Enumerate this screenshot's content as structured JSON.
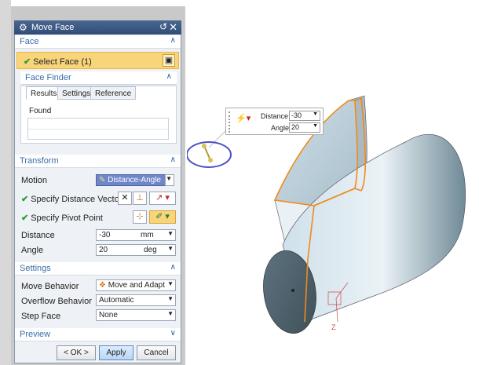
{
  "dialog": {
    "title": "Move Face",
    "reset_icon": "↺",
    "close_icon": "✕",
    "face_section": "Face",
    "select_face": "Select Face (1)",
    "face_finder": "Face Finder",
    "tabs": [
      "Results",
      "Settings",
      "Reference"
    ],
    "found_label": "Found",
    "transform_section": "Transform",
    "motion_label": "Motion",
    "motion_value": "Distance-Angle",
    "distance_vector_label": "Specify Distance Vector",
    "pivot_point_label": "Specify Pivot Point",
    "distance_label": "Distance",
    "distance_value": "-30",
    "distance_unit": "mm",
    "angle_label": "Angle",
    "angle_value": "20",
    "angle_unit": "deg",
    "settings_section": "Settings",
    "move_behavior_label": "Move Behavior",
    "move_behavior_value": "Move and Adapt",
    "overflow_label": "Overflow Behavior",
    "overflow_value": "Automatic",
    "step_face_label": "Step Face",
    "step_face_value": "None",
    "preview_section": "Preview",
    "ok_label": "< OK >",
    "apply_label": "Apply",
    "cancel_label": "Cancel"
  },
  "hud": {
    "distance_label": "Distance",
    "distance_value": "-30",
    "angle_label": "Angle",
    "angle_value": "20"
  },
  "viewport": {
    "axis_label": "Z"
  },
  "colors": {
    "title_bar": "#2f4d78",
    "section_text": "#3a6ea8",
    "highlight_row": "#f8d57a",
    "edge_highlight": "#f08a1c",
    "handle_ring": "#4b4fc4"
  }
}
